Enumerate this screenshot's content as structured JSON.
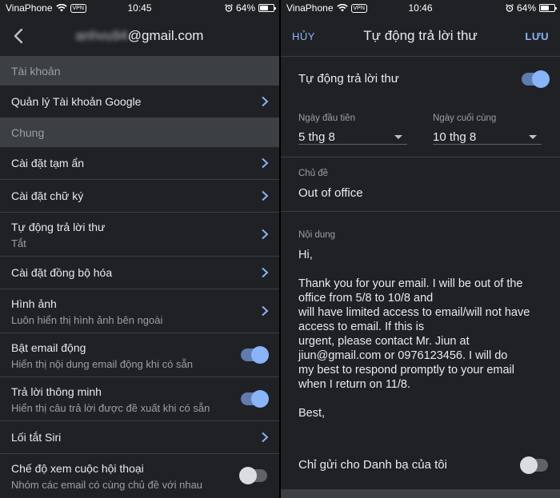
{
  "status_left": {
    "carrier": "VinaPhone",
    "vpn": "VPN",
    "time": "10:45",
    "battery": "64%"
  },
  "status_right": {
    "carrier": "VinaPhone",
    "vpn": "VPN",
    "time": "10:46",
    "battery": "64%"
  },
  "settings": {
    "email_hidden": "anhvu94",
    "email_domain": "@gmail.com",
    "sections": [
      {
        "label": "Tài khoản"
      },
      {
        "label": "Chung"
      }
    ],
    "items": [
      {
        "title": "Quản lý Tài khoản Google",
        "subtitle": ""
      },
      {
        "title": "Cài đặt tạm ẩn",
        "subtitle": ""
      },
      {
        "title": "Cài đặt chữ ký",
        "subtitle": ""
      },
      {
        "title": "Tự động trả lời thư",
        "subtitle": "Tắt"
      },
      {
        "title": "Cài đặt đồng bộ hóa",
        "subtitle": ""
      },
      {
        "title": "Hình ảnh",
        "subtitle": "Luôn hiển thị hình ảnh bên ngoài"
      },
      {
        "title": "Bật email động",
        "subtitle": "Hiển thị nội dung email động khi có sẵn",
        "toggle": true
      },
      {
        "title": "Trả lời thông minh",
        "subtitle": "Hiển thị câu trả lời được đề xuất khi có sẵn",
        "toggle": true
      },
      {
        "title": "Lối tắt Siri",
        "subtitle": ""
      },
      {
        "title": "Chế độ xem cuộc hội thoại",
        "subtitle": "Nhóm các email có cùng chủ đề với nhau",
        "toggle": false
      }
    ]
  },
  "auto_reply": {
    "cancel": "HỦY",
    "title": "Tự động trả lời thư",
    "save": "LƯU",
    "enable_label": "Tự động trả lời thư",
    "enabled": true,
    "first_day_label": "Ngày đầu tiên",
    "first_day_value": "5 thg 8",
    "last_day_label": "Ngày cuối cùng",
    "last_day_value": "10 thg 8",
    "subject_label": "Chủ đề",
    "subject_value": "Out of office",
    "body_label": "Nội dung",
    "body_lines": [
      "Hi,",
      "",
      "Thank you for your email. I will be out of the",
      "office from 5/8 to 10/8 and",
      "will have limited access to email/will not have",
      "access to email. If this is",
      "urgent, please contact Mr. Jiun at",
      "jiun@gmail.com or 0976123456. I will do",
      "my best to respond promptly to your email",
      "when I return on 11/8.",
      "",
      "Best,"
    ],
    "contacts_only_label": "Chỉ gửi cho Danh bạ của tôi",
    "contacts_only": false
  },
  "colors": {
    "accent": "#8ab4f8",
    "background": "#202124",
    "section": "#3c4043"
  },
  "icons": [
    "back-arrow-icon",
    "chevron-right-icon",
    "wifi-icon",
    "alarm-icon",
    "battery-icon"
  ]
}
